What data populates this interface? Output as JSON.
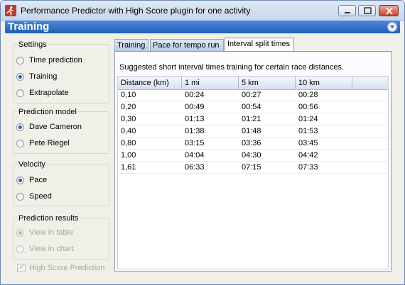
{
  "window": {
    "title": "Performance Predictor with High Score plugin for one activity"
  },
  "header": {
    "title": "Training"
  },
  "sidebar": {
    "settings": {
      "title": "Settings",
      "options": [
        "Time prediction",
        "Training",
        "Extrapolate"
      ],
      "selected": "Training"
    },
    "prediction_model": {
      "title": "Prediction model",
      "options": [
        "Dave Cameron",
        "Pete Riegel"
      ],
      "selected": "Dave Cameron"
    },
    "velocity": {
      "title": "Velocity",
      "options": [
        "Pace",
        "Speed"
      ],
      "selected": "Pace"
    },
    "prediction_results": {
      "title": "Prediction results",
      "options": [
        "View in table",
        "View in chart"
      ],
      "selected": "View in table",
      "disabled": true
    },
    "high_score": {
      "label": "High Score Prediction",
      "checked": true,
      "disabled": true
    }
  },
  "tabs": [
    {
      "label": "Training"
    },
    {
      "label": "Pace for  tempo run"
    },
    {
      "label": "Interval split times"
    }
  ],
  "active_tab": "Interval split times",
  "panel": {
    "description": "Suggested short interval times training for certain race distances.",
    "columns": [
      "Distance (km)",
      "1 mi",
      "5 km",
      "10 km"
    ],
    "rows": [
      [
        "0,10",
        "00:24",
        "00:27",
        "00:28"
      ],
      [
        "0,20",
        "00:49",
        "00:54",
        "00:56"
      ],
      [
        "0,30",
        "01:13",
        "01:21",
        "01:24"
      ],
      [
        "0,40",
        "01:38",
        "01:48",
        "01:53"
      ],
      [
        "0,80",
        "03:15",
        "03:36",
        "03:45"
      ],
      [
        "1,00",
        "04:04",
        "04:30",
        "04:42"
      ],
      [
        "1,61",
        "06:33",
        "07:15",
        "07:33"
      ]
    ]
  },
  "colors": {
    "header_bar": "#2f6fc9",
    "radio_selected": "#2a5fb0",
    "window_face": "#f0efe8"
  }
}
